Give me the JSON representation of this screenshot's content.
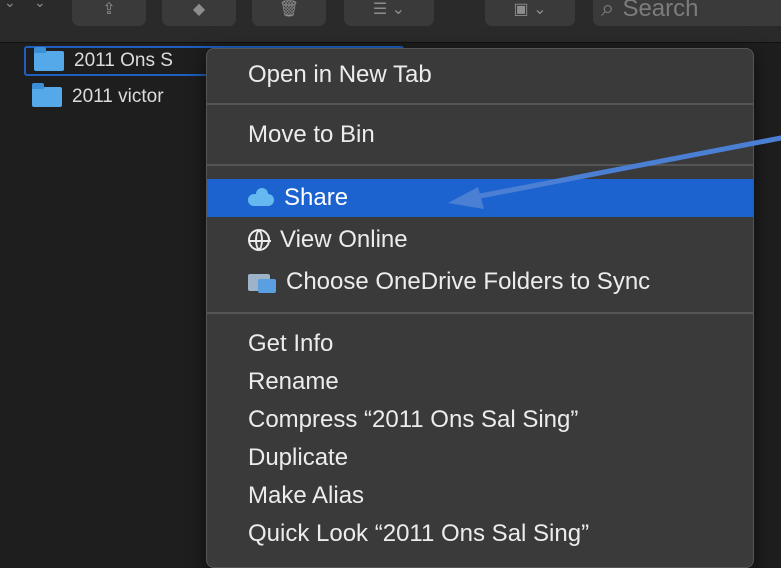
{
  "toolbar": {
    "buttons": [
      "chevron-down-icon",
      "share-icon",
      "tag-icon",
      "trash-icon",
      "group-icon",
      "zip-icon"
    ],
    "search_placeholder": "Search"
  },
  "files": [
    {
      "name": "2011 Ons S",
      "selected": true
    },
    {
      "name": "2011 victor",
      "selected": false
    }
  ],
  "context_menu": {
    "groups": [
      [
        {
          "label": "Open in New Tab"
        }
      ],
      [
        {
          "label": "Move to Bin"
        }
      ],
      [
        {
          "label": "Share",
          "icon": "cloud-icon",
          "highlighted": true
        },
        {
          "label": "View Online",
          "icon": "globe-icon"
        },
        {
          "label": "Choose OneDrive Folders to Sync",
          "icon": "sync-icon"
        }
      ],
      [
        {
          "label": "Get Info"
        },
        {
          "label": "Rename"
        },
        {
          "label": "Compress “2011 Ons Sal Sing”"
        },
        {
          "label": "Duplicate"
        },
        {
          "label": "Make Alias"
        },
        {
          "label": "Quick Look “2011 Ons Sal Sing”"
        }
      ]
    ]
  },
  "colors": {
    "highlight": "#1c63d0",
    "annotation_arrow": "#4a7fd4",
    "folder": "#56a9e8"
  }
}
